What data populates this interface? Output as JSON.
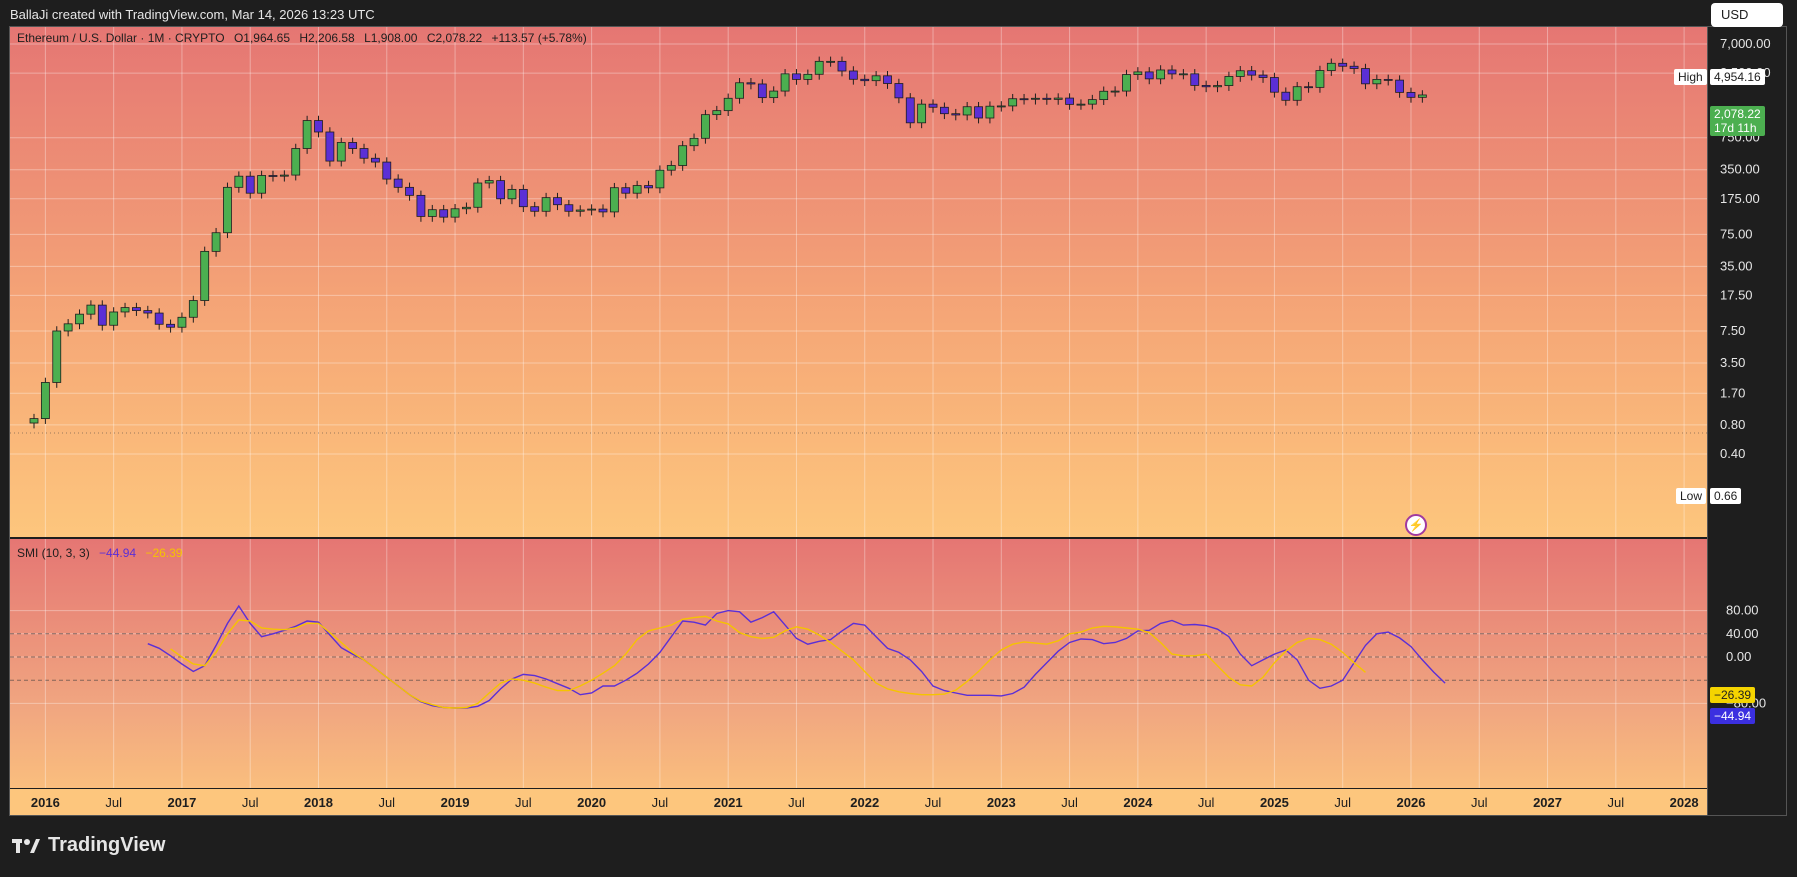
{
  "header": {
    "attribution": "BallaJi created with TradingView.com, Mar 14, 2026 13:23 UTC"
  },
  "footer": {
    "brand": "TradingView"
  },
  "currency": "USD",
  "main_legend": {
    "symbol": "Ethereum / U.S. Dollar · 1M · CRYPTO",
    "open": "O1,964.65",
    "high": "H2,206.58",
    "low": "L1,908.00",
    "close": "C2,078.22",
    "change": "+113.57 (+5.78%)"
  },
  "smi_legend": {
    "name": "SMI (10, 3, 3)",
    "v1": "−44.94",
    "v2": "−26.39"
  },
  "tags": {
    "high_label": "High",
    "high_value": "4,954.16",
    "low_label": "Low",
    "low_value": "0.66",
    "last_price": "2,078.22",
    "countdown": "17d 11h",
    "smi_signal": "−26.39",
    "smi_value": "−44.94"
  },
  "colors": {
    "up": "#4caf50",
    "down": "#5b2fd6",
    "smi": "#5b2fd6",
    "signal": "#f5c400",
    "bg_top": "#e57673",
    "bg_bottom": "#fdc67d"
  },
  "chart_data": [
    {
      "type": "candlestick",
      "title": "Ethereum / U.S. Dollar · 1M · CRYPTO",
      "scale": "log",
      "y_ticks": [
        "7,000.00",
        "3,500.00",
        "750.00",
        "350.00",
        "175.00",
        "75.00",
        "35.00",
        "17.50",
        "7.50",
        "3.50",
        "1.70",
        "0.80",
        "0.40"
      ],
      "y_tick_values": [
        7000,
        3500,
        750,
        350,
        175,
        75,
        35,
        17.5,
        7.5,
        3.5,
        1.7,
        0.8,
        0.4
      ],
      "x_ticks": [
        "2016",
        "Jul",
        "2017",
        "Jul",
        "2018",
        "Jul",
        "2019",
        "Jul",
        "2020",
        "Jul",
        "2021",
        "Jul",
        "2022",
        "Jul",
        "2023",
        "Jul",
        "2024",
        "Jul",
        "2025",
        "Jul",
        "2026",
        "Jul",
        "2027",
        "Jul",
        "2028"
      ],
      "start": "2015-12",
      "close": [
        0.93,
        2.2,
        7.5,
        8.9,
        11.2,
        13.9,
        8.6,
        11.8,
        13.1,
        12.2,
        11.5,
        8.8,
        8.2,
        10.4,
        15.5,
        50,
        78,
        230,
        300,
        200,
        305,
        300,
        308,
        580,
        1130,
        860,
        430,
        670,
        580,
        460,
        420,
        280,
        230,
        190,
        115,
        135,
        113,
        138,
        143,
        255,
        270,
        175,
        219,
        145,
        130,
        180,
        152,
        130,
        134,
        137,
        128,
        228,
        200,
        240,
        227,
        346,
        387,
        620,
        740,
        1300,
        1430,
        1920,
        2780,
        2700,
        1950,
        2280,
        3440,
        3010,
        3400,
        4630,
        4630,
        3680,
        3020,
        2920,
        3280,
        2730,
        1940,
        1070,
        1670,
        1550,
        1330,
        1290,
        1570,
        1200,
        1590,
        1600,
        1900,
        1880,
        1920,
        1870,
        1930,
        1660,
        1670,
        1860,
        2270,
        2280,
        3380,
        3600,
        3050,
        3770,
        3430,
        3440,
        2610,
        2525,
        2600,
        3230,
        3700,
        3335,
        3150,
        2220,
        1830,
        2530,
        2490,
        3720,
        4420,
        4120,
        3900,
        2710,
        3010,
        2960,
        2210,
        1964,
        2078
      ]
    },
    {
      "type": "line",
      "title": "SMI (10, 3, 3)",
      "y_ticks": [
        "80.00",
        "40.00",
        "0.00",
        "−80.00"
      ],
      "y_tick_values": [
        80,
        40,
        0,
        -80
      ],
      "series": [
        {
          "name": "",
          "start": "2016-10",
          "values": [
            23,
            15,
            2,
            -12,
            -25,
            -15,
            20,
            58,
            88,
            58,
            35,
            40,
            46,
            53,
            62,
            60,
            38,
            16,
            5,
            -5,
            -20,
            -35,
            -50,
            -65,
            -77,
            -84,
            -87,
            -88,
            -88,
            -85,
            -75,
            -55,
            -38,
            -30,
            -32,
            -38,
            -46,
            -54,
            -65,
            -62,
            -50,
            -50,
            -40,
            -28,
            -12,
            8,
            35,
            62,
            60,
            55,
            75,
            80,
            78,
            60,
            68,
            78,
            55,
            32,
            22,
            27,
            30,
            45,
            58,
            55,
            35,
            15,
            8,
            -5,
            -25,
            -50,
            -58,
            -62,
            -66,
            -66,
            -66,
            -67,
            -63,
            -52,
            -30,
            -10,
            10,
            25,
            31,
            30,
            23,
            25,
            32,
            45,
            46,
            58,
            63,
            55,
            56,
            54,
            48,
            35,
            5,
            -15,
            -5,
            5,
            12,
            -5,
            -40,
            -54,
            -50,
            -40,
            -10,
            20,
            40,
            43,
            33,
            18,
            -5,
            -26,
            -44.94
          ]
        },
        {
          "name": "",
          "start": "2016-12",
          "values": [
            14,
            0,
            -12,
            -15,
            8,
            40,
            64,
            62,
            50,
            48,
            47,
            50,
            58,
            58,
            42,
            25,
            8,
            -5,
            -20,
            -35,
            -50,
            -65,
            -76,
            -82,
            -87,
            -88,
            -87,
            -80,
            -62,
            -45,
            -38,
            -40,
            -45,
            -52,
            -58,
            -58,
            -50,
            -40,
            -28,
            -15,
            5,
            30,
            45,
            50,
            55,
            65,
            68,
            70,
            62,
            57,
            42,
            35,
            32,
            34,
            45,
            52,
            48,
            38,
            25,
            10,
            -5,
            -25,
            -45,
            -55,
            -60,
            -63,
            -65,
            -65,
            -64,
            -57,
            -42,
            -25,
            -5,
            12,
            22,
            26,
            24,
            22,
            28,
            40,
            43,
            50,
            53,
            52,
            50,
            48,
            42,
            25,
            5,
            2,
            2,
            5,
            -15,
            -35,
            -48,
            -50,
            -35,
            -10,
            10,
            25,
            32,
            30,
            22,
            8,
            -10,
            -26.39
          ]
        }
      ]
    }
  ]
}
